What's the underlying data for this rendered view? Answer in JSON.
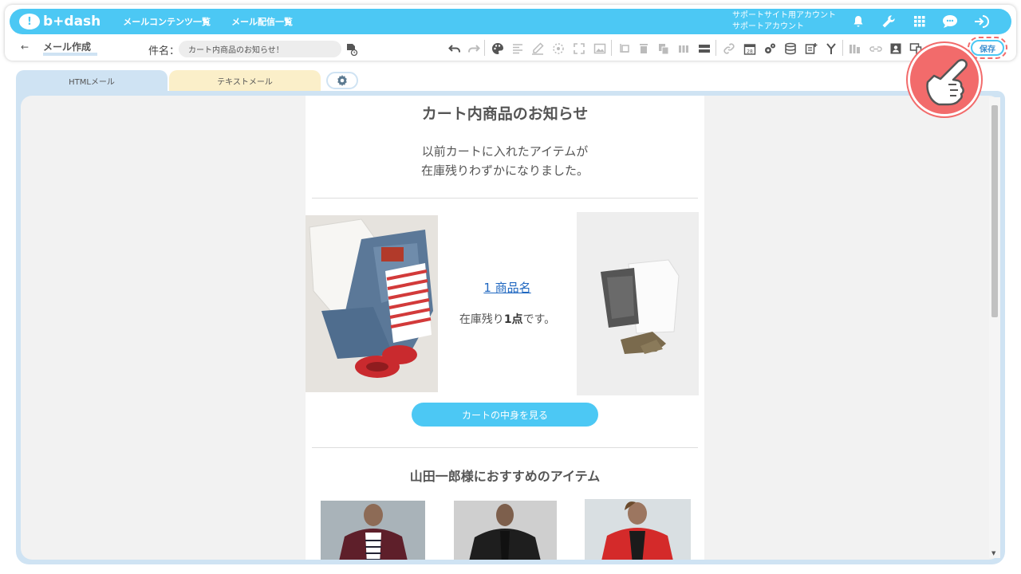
{
  "app": {
    "logo_text": "b+dash",
    "nav": [
      "メールコンテンツ一覧",
      "メール配信一覧"
    ],
    "account_line1": "サポートサイト用アカウント",
    "account_line2": "サポートアカウント",
    "brand_color": "#4cc8f4"
  },
  "toolbar": {
    "back_arrow": "←",
    "page_title": "メール作成",
    "subject_label": "件名：",
    "subject_value": "カート内商品のお知らせ！",
    "save_label": "保存"
  },
  "tabs": {
    "html_label": "HTMLメール",
    "text_label": "テキストメール"
  },
  "email": {
    "title": "カート内商品のお知らせ",
    "intro_line1": "以前カートに入れたアイテムが",
    "intro_line2": "在庫残りわずかになりました。",
    "product_link": "1 商品名",
    "stock_prefix": "在庫残り",
    "stock_count": "1点",
    "stock_suffix": "です。",
    "cart_button": "カートの中身を見る",
    "recommend_title": "山田一郎様におすすめのアイテム"
  }
}
